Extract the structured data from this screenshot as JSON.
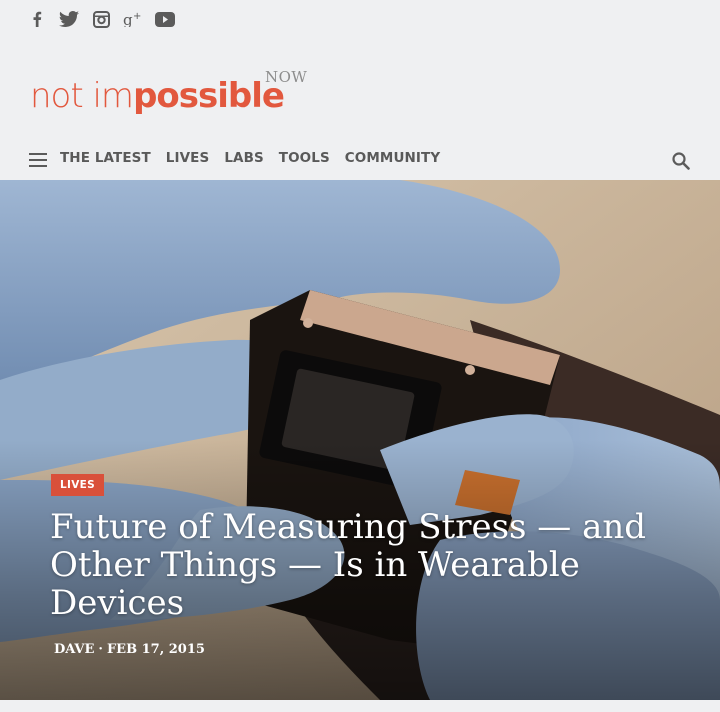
{
  "social": {
    "icons": [
      "facebook-icon",
      "twitter-icon",
      "instagram-icon",
      "google-plus-icon",
      "youtube-icon"
    ],
    "color": "#5b5b5b"
  },
  "logo": {
    "word_light": "not im",
    "word_bold": "possible",
    "superscript": "NOW",
    "accent": "#e2583e"
  },
  "nav": {
    "items": [
      "THE LATEST",
      "LIVES",
      "LABS",
      "TOOLS",
      "COMMUNITY"
    ]
  },
  "article": {
    "category": "LIVES",
    "title": "Future of Measuring Stress — and Other Things — Is in Wearable Devices",
    "author": "DAVE",
    "separator": "·",
    "date": "FEB 17, 2015",
    "badge_color": "#d9503a"
  }
}
